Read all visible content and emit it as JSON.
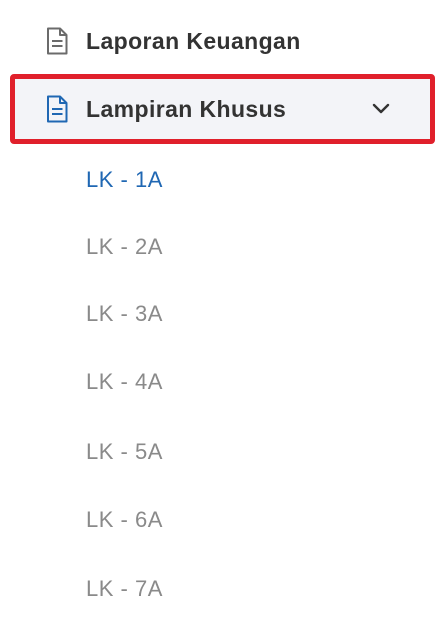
{
  "menu": {
    "items": [
      {
        "label": "Laporan Keuangan",
        "icon": "document-icon"
      },
      {
        "label": "Lampiran Khusus",
        "icon": "document-icon",
        "expanded": true
      }
    ],
    "submenu": [
      {
        "label": "LK - 1A",
        "active": true
      },
      {
        "label": "LK - 2A"
      },
      {
        "label": "LK - 3A"
      },
      {
        "label": "LK - 4A"
      },
      {
        "label": "LK - 5A"
      },
      {
        "label": "LK - 6A"
      },
      {
        "label": "LK - 7A"
      }
    ]
  },
  "colors": {
    "highlight_border": "#e0202b",
    "active_link": "#1f67b3",
    "inactive_link": "#8a8a8a",
    "label": "#333333"
  }
}
